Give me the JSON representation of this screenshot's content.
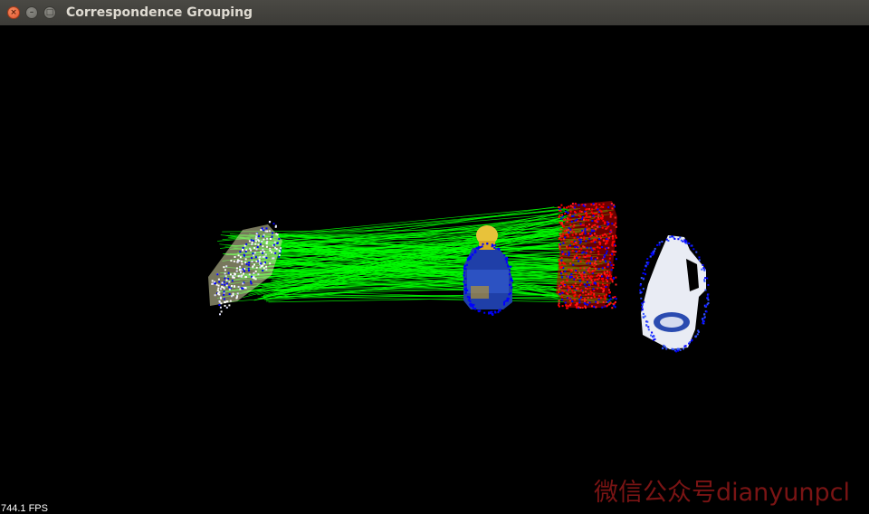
{
  "window": {
    "title": "Correspondence Grouping",
    "close_glyph": "×",
    "minimize_glyph": "–",
    "maximize_glyph": "□"
  },
  "viewer": {
    "fps_text": "744.1 FPS",
    "background": "#000000",
    "correspondence_color": "#00ff00",
    "scene_model_color": "#ff0000",
    "keypoint_color": "#0000ff"
  },
  "watermark": {
    "text": "微信公众号dianyunpcl"
  }
}
